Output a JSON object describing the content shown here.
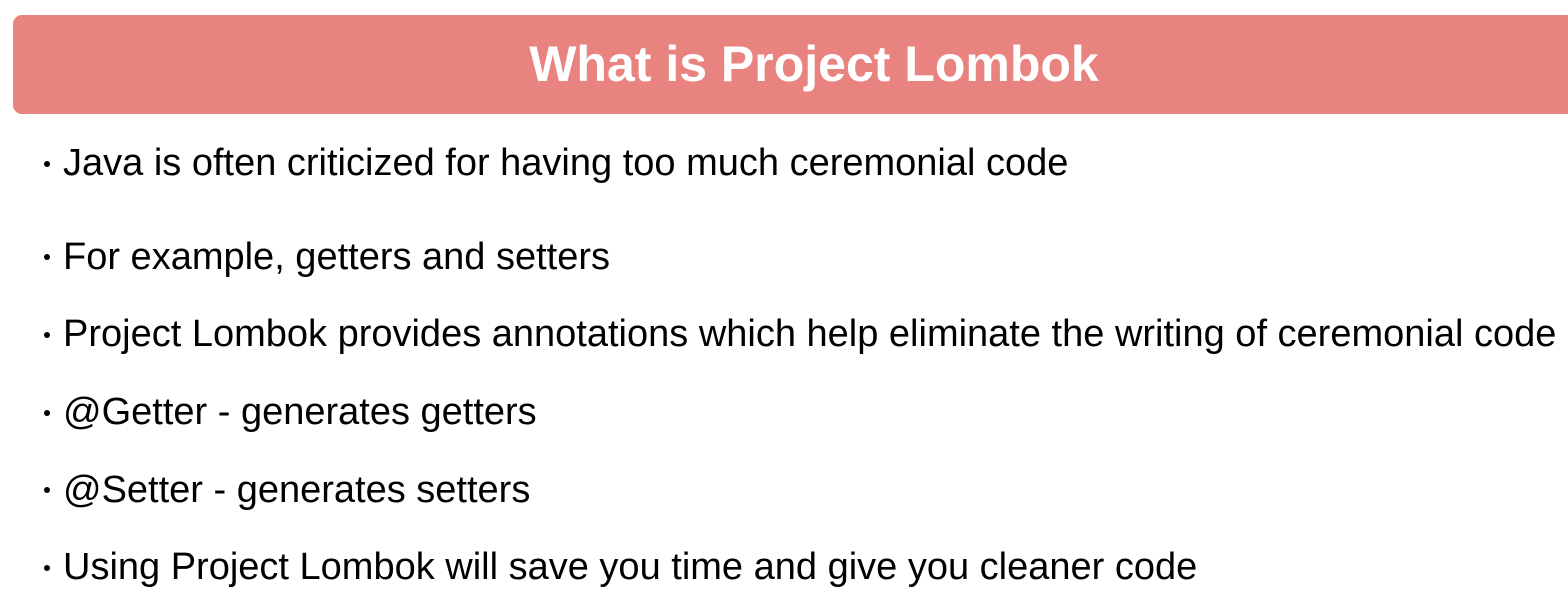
{
  "slide": {
    "title": "What is Project Lombok",
    "bullets": [
      "Java is often criticized for having too much ceremonial code",
      "For example, getters and setters",
      "Project Lombok provides annotations which help eliminate the writing of ceremonial code",
      "@Getter - generates getters",
      "@Setter - generates setters",
      "Using Project Lombok will save you time and give you cleaner code"
    ]
  },
  "colors": {
    "banner": "#e98380",
    "title_text": "#ffffff",
    "body_text": "#000000"
  }
}
